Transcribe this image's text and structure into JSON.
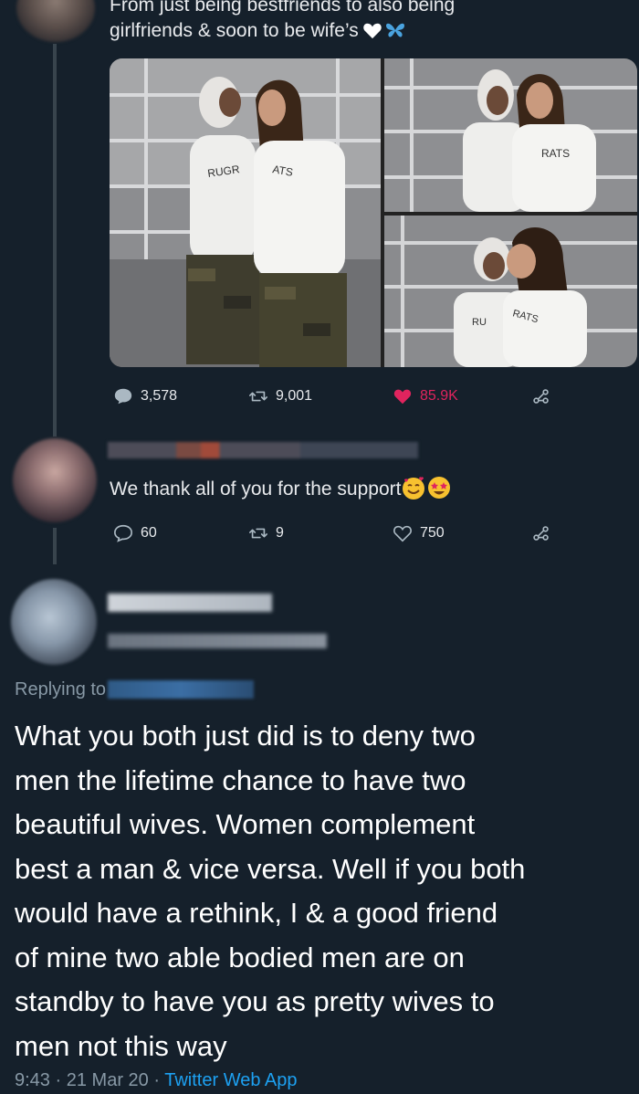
{
  "tweet1": {
    "text_line1": "From just being bestfriends to also being",
    "text_line2": "girlfriends & soon to be wife’s",
    "emojis": [
      "white-heart",
      "butterfly"
    ],
    "photos": [
      {
        "alt_label": "RUGRATS"
      },
      {
        "alt_label": "RATS"
      },
      {
        "alt_label": "RUGRATS"
      }
    ],
    "actions": {
      "replies": "3,578",
      "retweets": "9,001",
      "likes": "85.9K"
    },
    "like_color": "#e0245e"
  },
  "tweet2": {
    "text": "We thank all of you for the support",
    "emojis": [
      "smiling-face-with-hearts",
      "star-struck"
    ],
    "actions": {
      "replies": "60",
      "retweets": "9",
      "likes": "750"
    }
  },
  "reply": {
    "replying_to_label": "Replying to",
    "body_lines": [
      "What you both just did is to deny two",
      "men the lifetime chance to have two",
      "beautiful wives. Women complement",
      "best a man & vice versa. Well if you both",
      "would have a rethink, I & a good friend",
      "of mine two able bodied men are on",
      "standby to have you as pretty wives to",
      "men not this way"
    ],
    "time": "9:43",
    "date": "21 Mar 20",
    "separator": "·",
    "app": "Twitter Web App"
  },
  "colors": {
    "background": "#15202b",
    "secondary_text": "#8899a6",
    "link": "#1da1f2",
    "like": "#e0245e"
  }
}
